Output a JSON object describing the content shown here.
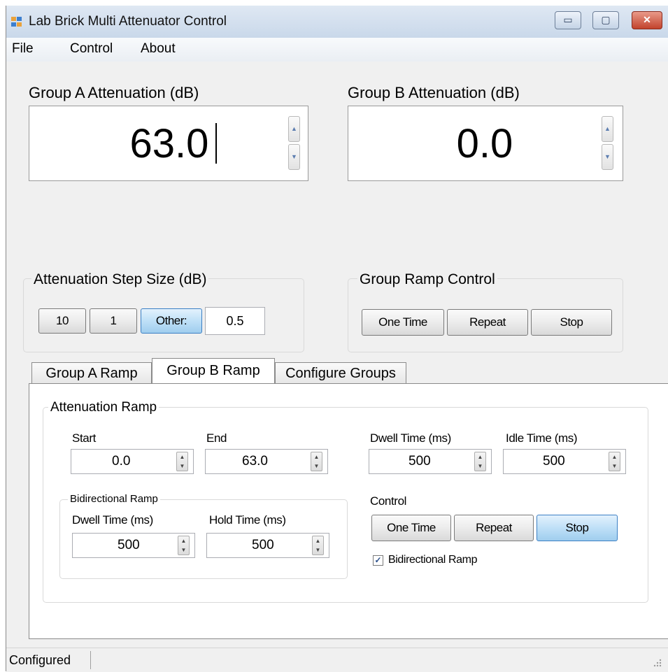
{
  "window": {
    "title": "Lab Brick Multi Attenuator Control",
    "buttons": {
      "minimize": "▭",
      "maximize": "▢",
      "close": "✕"
    }
  },
  "menu": {
    "file": "File",
    "control": "Control",
    "about": "About"
  },
  "groupA": {
    "label": "Group A Attenuation (dB)",
    "value": "63.0"
  },
  "groupB": {
    "label": "Group B Attenuation (dB)",
    "value": "0.0"
  },
  "step": {
    "title": "Attenuation Step Size (dB)",
    "btn10": "10",
    "btn1": "1",
    "btnOther": "Other:",
    "other_value": "0.5"
  },
  "ramp_control": {
    "title": "Group Ramp Control",
    "one_time": "One Time",
    "repeat": "Repeat",
    "stop": "Stop"
  },
  "tabs": {
    "a": "Group A Ramp",
    "b": "Group B Ramp",
    "c": "Configure Groups",
    "selected": "Group B Ramp"
  },
  "atten_ramp": {
    "title": "Attenuation Ramp",
    "start_label": "Start",
    "start_value": "0.0",
    "end_label": "End",
    "end_value": "63.0",
    "dwell_label": "Dwell Time (ms)",
    "dwell_value": "500",
    "idle_label": "Idle Time (ms)",
    "idle_value": "500"
  },
  "bidir": {
    "title": "Bidirectional Ramp",
    "dwell_label": "Dwell Time (ms)",
    "dwell_value": "500",
    "hold_label": "Hold Time (ms)",
    "hold_value": "500"
  },
  "control": {
    "label": "Control",
    "one_time": "One Time",
    "repeat": "Repeat",
    "stop": "Stop",
    "active": "Stop"
  },
  "bidir_checkbox": {
    "label": "Bidirectional Ramp",
    "checked": true,
    "mark": "✓"
  },
  "status": {
    "text": "Configured"
  },
  "arrows": {
    "up": "▲",
    "down": "▼"
  },
  "colors": {
    "titlebar": "#c9d8ea",
    "active_button": "#bfe0f7",
    "close_button": "#c2432c"
  }
}
